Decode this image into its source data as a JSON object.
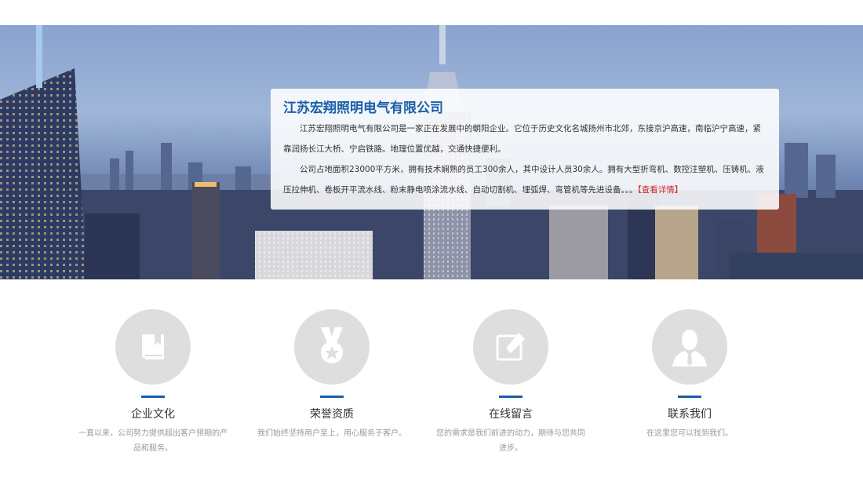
{
  "colors": {
    "brand_blue": "#1a5fa8",
    "link_red": "#d0262b",
    "icon_circle": "#dedede",
    "muted_text": "#999999"
  },
  "intro": {
    "title": "江苏宏翔照明电气有限公司",
    "p1": "江苏宏翔照明电气有限公司是一家正在发展中的朝阳企业。它位于历史文化名城扬州市北郊，东接京沪高速，南临沪宁高速，紧靠润扬长江大桥、宁启铁路。地理位置优越，交通快捷便利。",
    "p2": "公司占地面积23000平方米，拥有技术娴熟的员工300余人，其中设计人员30余人。拥有大型折弯机、数控注塑机、压铸机、液压拉伸机、卷板开平流水线、粉末静电喷涂流水线、自动切割机、埋弧焊、弯管机等先进设备。。。",
    "more_label": "【查看详情】"
  },
  "features": [
    {
      "icon": "book-icon",
      "title": "企业文化",
      "desc": "一直以来，公司努力提供超出客户预期的产品和服务。"
    },
    {
      "icon": "medal-icon",
      "title": "荣誉资质",
      "desc": "我们始终坚持用户至上，用心服务于客户。"
    },
    {
      "icon": "edit-icon",
      "title": "在线留言",
      "desc": "您的需求是我们前进的动力，期待与您共同进步。"
    },
    {
      "icon": "user-icon",
      "title": "联系我们",
      "desc": "在这里您可以找到我们。"
    }
  ]
}
